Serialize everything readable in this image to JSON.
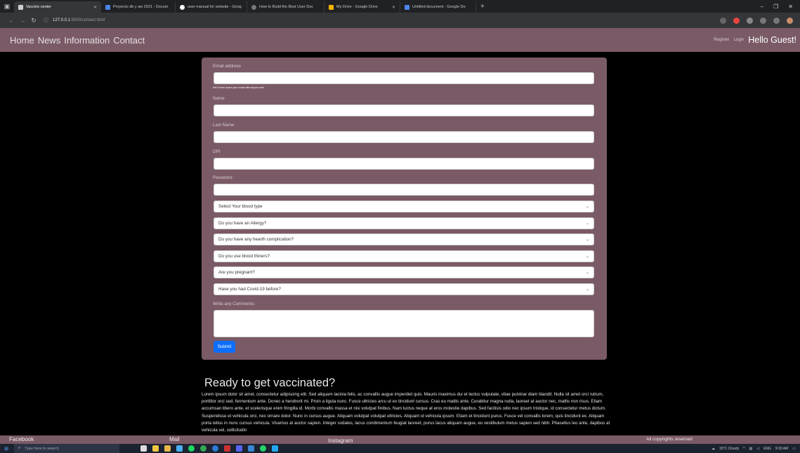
{
  "browser": {
    "tabs": [
      {
        "title": "Vaccine center",
        "active": true,
        "color": "#cfcfcf"
      },
      {
        "title": "Proyecto db y aw 2021 - Docum",
        "active": false,
        "color": "#4a86e8"
      },
      {
        "title": "user manual for website - Goog",
        "active": false,
        "color": "#ffffff"
      },
      {
        "title": "How to Build the Best User Doc",
        "active": false,
        "color": "#777777"
      },
      {
        "title": "My Drive - Google Drive",
        "active": false,
        "color": "#f4b400"
      },
      {
        "title": "Untitled document - Google Do",
        "active": false,
        "color": "#4a86e8"
      }
    ],
    "url_host": "127.0.0.1",
    "url_path": ":5500/contact.html"
  },
  "nav": {
    "home": "Home",
    "news": "News",
    "information": "Information",
    "contact": "Contact",
    "register": "Register",
    "login": "Login",
    "greeting": "Hello Guest!"
  },
  "form": {
    "email_label": "Email address",
    "email_help": "We'll never share your email with anyone else.",
    "name_label": "Name",
    "last_name_label": "Last Name",
    "dpi_label": "DPI",
    "password_label": "Password",
    "selects": [
      "Select Your blood type",
      "Do you have an Allergy?",
      "Do you have any hearth complication?",
      "Do you use blood thiners?",
      "Are you pregnant?",
      "Have you had Covid-19 before?"
    ],
    "comments_label": "Write any Comments:",
    "submit_label": "Submit"
  },
  "section": {
    "heading": "Ready to get vaccinated?",
    "body": "Lorem ipsum dolor sit amet, consectetur adipiscing elit. Sed aliquam lacinia felis, ac convallis augue imperdiet quis. Mauris maximus dui et lectus vulputate, vitae pulvinar diam blandit. Nulla sit amet orci rutrum, porttitor orci sed, fermentum ante. Donec a hendrerit mi. Proin a ligula nunc. Fusce ultricies arcu ut ex tincidunt cursus. Cras eu mattis ante. Curabitur magna nulla, laoreet at auctor nec, mattis non risus. Etiam accumsan libero ante, et scelerisque enim fringilla id. Morbi convallis massa et nisi volutpat finibus. Nam luctus neque at eros molestie dapibus. Sed facilisis odio nec ipsum tristique, id consectetur metus dictum. Suspendisse et vehicula orci, nec ornare dolor. Nunc in cursus augue. Aliquam volutpat volutpat ultricies. Aliquam id vehicula ipsum. Etiam et tincidunt purus. Fusce vel convallis lorem, quis tincidunt ex. Aliquam porta tellus in nunc cursus vehicula. Vivamus at auctor sapien. Integer sodales, lacus condimentum feugiat laoreet, purus lacus aliquam augue, eu vestibulum metus sapien sed nibh. Phasellus leo ante, dapibus at vehicula vel, sollicitudin"
  },
  "footer": {
    "facebook": "Facebook",
    "mail": "Mail",
    "instagram": "Instagram",
    "copyright": "All copyrights reserved"
  },
  "taskbar": {
    "search_placeholder": "Type here to search",
    "weather": "15°C Cloudy",
    "lang": "ENG",
    "time": "9:33 AM"
  },
  "colors": {
    "accent": "#7a5a66",
    "submit": "#0d6efd"
  }
}
